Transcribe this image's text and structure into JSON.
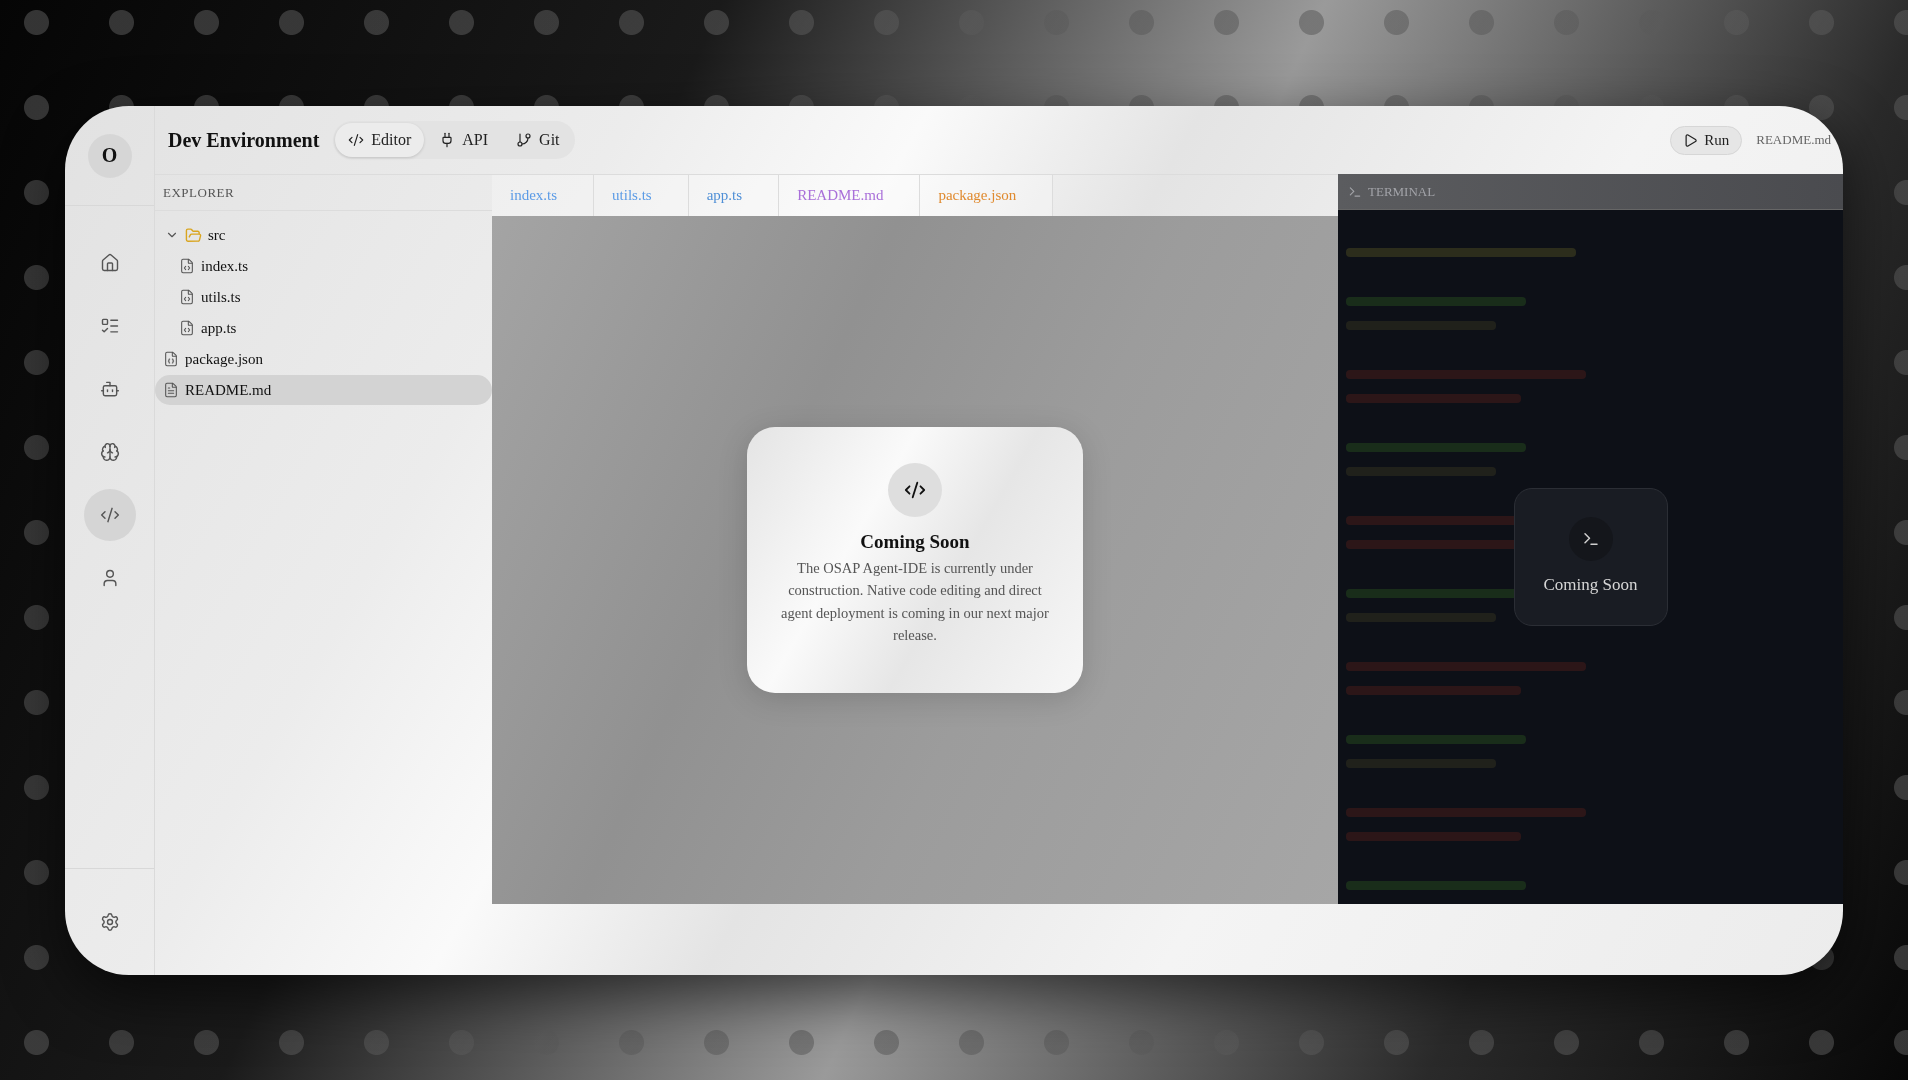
{
  "rail": {
    "avatar": "O",
    "items": [
      {
        "selected": false
      },
      {
        "selected": false
      },
      {
        "selected": false
      },
      {
        "selected": false
      },
      {
        "selected": true
      },
      {
        "selected": false
      }
    ]
  },
  "header": {
    "title": "Dev Environment",
    "tabs": [
      {
        "label": "Editor",
        "selected": true
      },
      {
        "label": "API",
        "selected": false
      },
      {
        "label": "Git",
        "selected": false
      }
    ],
    "run_button": "Run",
    "current_file": "README.md"
  },
  "explorer": {
    "title": "EXPLORER",
    "tree": [
      {
        "name": "src",
        "kind": "folder",
        "expanded": true,
        "selected": false,
        "children": [
          {
            "name": "index.ts",
            "kind": "code",
            "selected": false
          },
          {
            "name": "utils.ts",
            "kind": "code",
            "selected": false
          },
          {
            "name": "app.ts",
            "kind": "code",
            "selected": false
          }
        ]
      },
      {
        "name": "package.json",
        "kind": "json",
        "selected": false
      },
      {
        "name": "README.md",
        "kind": "text",
        "selected": true
      }
    ]
  },
  "editor": {
    "tabs": [
      {
        "label": "index.ts",
        "color": "#5b9be6"
      },
      {
        "label": "utils.ts",
        "color": "#5b9be6"
      },
      {
        "label": "app.ts",
        "color": "#4f8fd6"
      },
      {
        "label": "README.md",
        "color": "#a96fd9"
      },
      {
        "label": "package.json",
        "color": "#e08a2e"
      }
    ],
    "notice": {
      "title": "Coming Soon",
      "message": "The OSAP Agent-IDE is currently under construction. Native code editing and direct agent deployment is coming in our next major release."
    }
  },
  "terminal": {
    "title": "TERMINAL",
    "notice": "Coming Soon"
  }
}
